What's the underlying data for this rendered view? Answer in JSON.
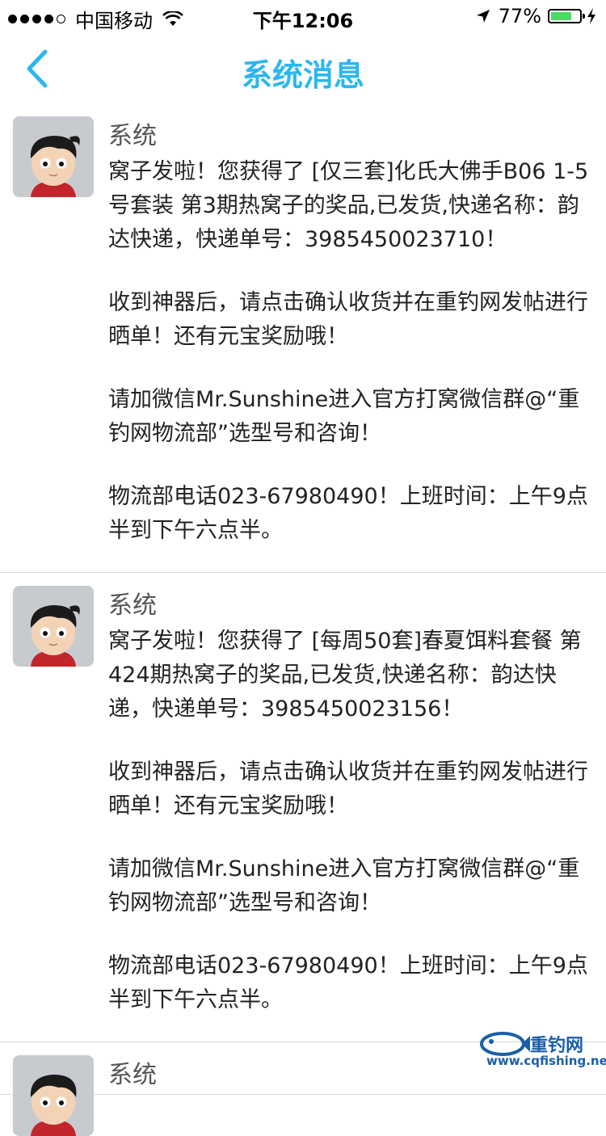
{
  "status_bar": {
    "carrier": "中国移动",
    "time": "下午12:06",
    "battery_percent": "77%",
    "battery_level": 0.77
  },
  "nav": {
    "title": "系统消息",
    "back_icon": "chevron-left-icon",
    "accent_color": "#2bb7ef"
  },
  "messages": [
    {
      "sender": "系统",
      "paragraphs": [
        "窝子发啦！您获得了 [仅三套]化氏大佛手B06 1-5号套装 第3期热窝子的奖品,已发货,快递名称：韵达快递，快递单号：3985450023710！",
        "收到神器后，请点击确认收货并在重钓网发帖进行晒单！还有元宝奖励哦！",
        "请加微信Mr.Sunshine进入官方打窝微信群@“重钓网物流部”选型号和咨询！",
        "物流部电话023-67980490！上班时间：上午9点半到下午六点半。"
      ]
    },
    {
      "sender": "系统",
      "paragraphs": [
        "窝子发啦！您获得了 [每周50套]春夏饵料套餐 第424期热窝子的奖品,已发货,快递名称：韵达快递，快递单号：3985450023156！",
        "收到神器后，请点击确认收货并在重钓网发帖进行晒单！还有元宝奖励哦！",
        "请加微信Mr.Sunshine进入官方打窝微信群@“重钓网物流部”选型号和咨询！",
        "物流部电话023-67980490！上班时间：上午9点半到下午六点半。"
      ]
    },
    {
      "sender": "系统",
      "paragraphs": []
    }
  ],
  "watermark": {
    "brand": "重钓网",
    "url": "www.cqfishing.net"
  }
}
